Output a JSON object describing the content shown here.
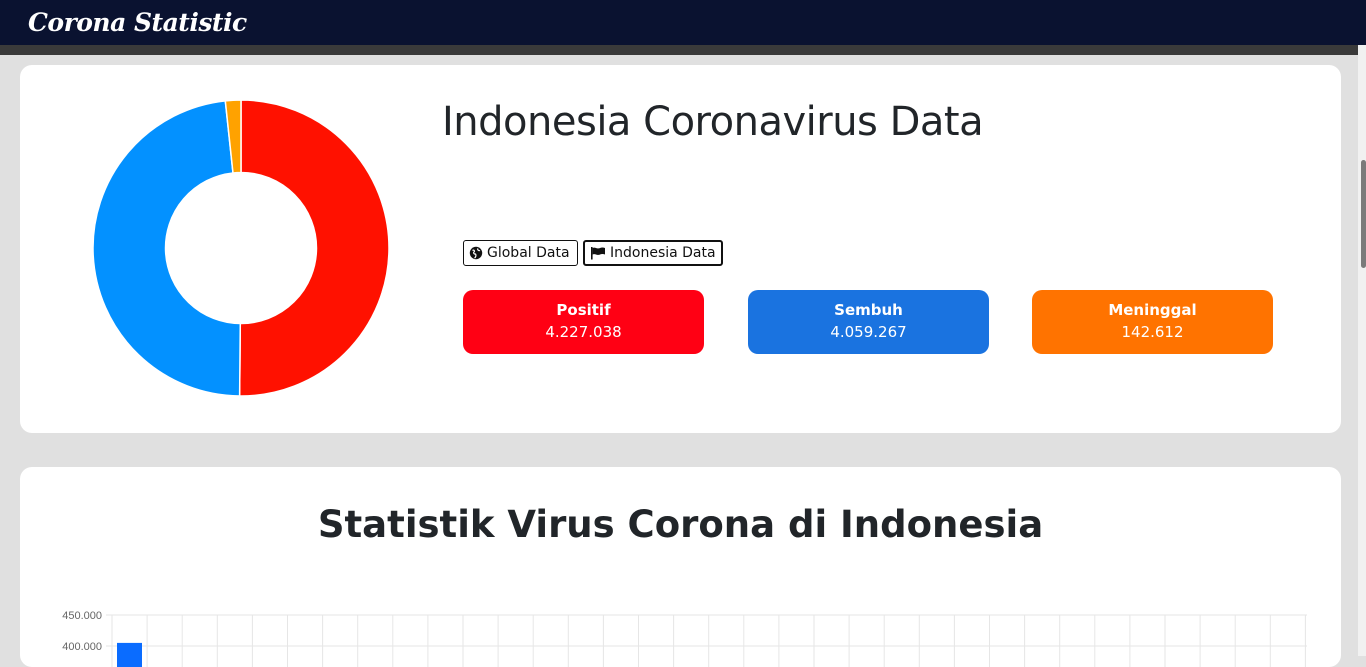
{
  "nav": {
    "brand": "Corona Statistic"
  },
  "summary": {
    "title": "Indonesia Coronavirus Data",
    "tabs": [
      {
        "label": "Global Data",
        "icon": "globe-icon"
      },
      {
        "label": "Indonesia Data",
        "icon": "flag-icon"
      }
    ],
    "stats": [
      {
        "label": "Positif",
        "value": "4.227.038",
        "color": "#ff0014"
      },
      {
        "label": "Sembuh",
        "value": "4.059.267",
        "color": "#1a73e0"
      },
      {
        "label": "Meninggal",
        "value": "142.612",
        "color": "#ff7300"
      }
    ]
  },
  "donut_chart": {
    "chart_data": {
      "type": "pie",
      "labels": [
        "Positif",
        "Sembuh",
        "Meninggal"
      ],
      "values": [
        4227038,
        4059267,
        142612
      ],
      "colors": [
        "#ff1100",
        "#0391ff",
        "#ffa200"
      ],
      "hole_ratio": 0.51
    }
  },
  "statistics": {
    "title": "Statistik Virus Corona di Indonesia",
    "chart_data": {
      "type": "bar",
      "ytick_labels": [
        "450.000",
        "400.000"
      ],
      "yticks": [
        450000,
        400000
      ],
      "values": [
        405000
      ],
      "bar_color": "#0a6cff",
      "grid": true
    }
  }
}
